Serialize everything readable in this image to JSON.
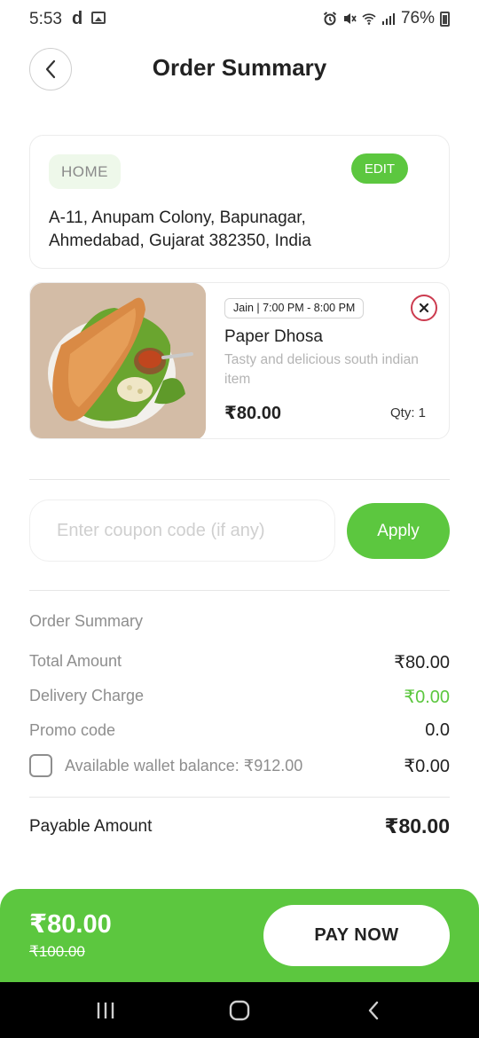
{
  "status_bar": {
    "time": "5:53",
    "app_letter": "d",
    "battery": "76%"
  },
  "header": {
    "title": "Order Summary",
    "back_icon": "chevron-left-icon"
  },
  "address": {
    "tag": "HOME",
    "edit_label": "EDIT",
    "line1": "A-11, Anupam Colony, Bapunagar,",
    "line2": "Ahmedabad, Gujarat 382350, India"
  },
  "item": {
    "time_slot": "Jain | 7:00 PM - 8:00 PM",
    "name": "Paper Dhosa",
    "description": "Tasty and delicious south indian item",
    "price": "₹80.00",
    "qty": "Qty: 1",
    "remove_icon": "close-circle-icon"
  },
  "coupon": {
    "placeholder": "Enter coupon code (if any)",
    "value": "",
    "apply_label": "Apply"
  },
  "summary": {
    "heading": "Order Summary",
    "rows": [
      {
        "label": "Total Amount",
        "value": "₹80.00"
      },
      {
        "label": "Delivery Charge",
        "value": "₹0.00"
      },
      {
        "label": "Promo code",
        "value": "0.0"
      },
      {
        "label": "Available wallet balance: ₹912.00",
        "value": "₹0.00"
      }
    ],
    "payable_label": "Payable Amount",
    "payable_value": "₹80.00"
  },
  "pay_bar": {
    "price": "₹80.00",
    "original_price": "₹100.00",
    "button_label": "PAY NOW"
  },
  "colors": {
    "accent": "#5cc73f",
    "remove": "#cc3b4f",
    "muted_text": "#8e8e8e"
  }
}
